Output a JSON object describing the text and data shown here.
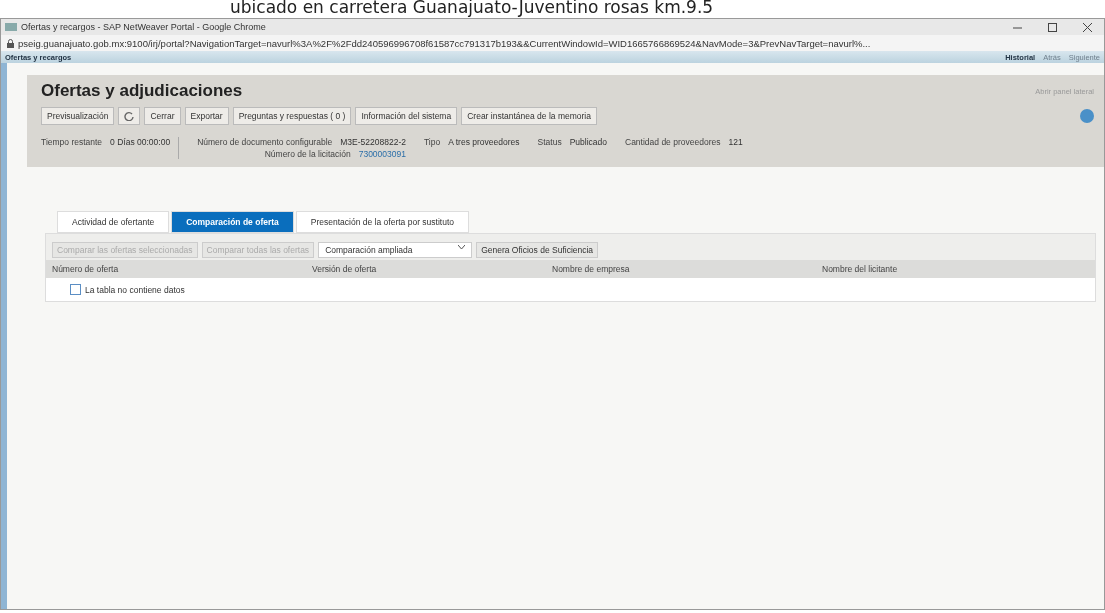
{
  "document_text": "ubicado en carretera Guanajuato-Juventino rosas km.9.5",
  "browser": {
    "title": "Ofertas y recargos - SAP NetWeaver Portal - Google Chrome",
    "url": "pseig.guanajuato.gob.mx:9100/irj/portal?NavigationTarget=navurl%3A%2F%2Fdd240596996708f61587cc791317b193&&CurrentWindowId=WID1665766869524&NavMode=3&PrevNavTarget=navurl%..."
  },
  "portal": {
    "title": "Ofertas y recargos",
    "nav": [
      {
        "label": "Historial",
        "disabled": false
      },
      {
        "label": "Atrás",
        "disabled": true
      },
      {
        "label": "Siguiente",
        "disabled": true
      }
    ]
  },
  "page": {
    "title": "Ofertas y adjudicaciones",
    "side_link": "Abrir panel lateral",
    "toolbar": [
      {
        "kind": "text",
        "label": "Previsualización"
      },
      {
        "kind": "refresh"
      },
      {
        "kind": "text",
        "label": "Cerrar"
      },
      {
        "kind": "text",
        "label": "Exportar"
      },
      {
        "kind": "text",
        "label": "Preguntas y respuestas ( 0 )"
      },
      {
        "kind": "text",
        "label": "Información del sistema"
      },
      {
        "kind": "text",
        "label": "Crear instantánea de la memoria"
      }
    ],
    "info": [
      {
        "label": "Tiempo restante",
        "value": "0 Días 00:00:00"
      },
      {
        "label": "Número de documento configurable",
        "value": "M3E-52208822-2",
        "sub_label": "Número de la licitación",
        "sub_value": "7300003091"
      },
      {
        "label": "Tipo",
        "value": "A tres proveedores"
      },
      {
        "label": "Status",
        "value": "Publicado"
      },
      {
        "label": "Cantidad de proveedores",
        "value": "121"
      }
    ]
  },
  "tabs": [
    {
      "label": "Actividad de ofertante",
      "selected": false
    },
    {
      "label": "Comparación de oferta",
      "selected": true
    },
    {
      "label": "Presentación de la oferta por sustituto",
      "selected": false
    }
  ],
  "table_toolbar": [
    {
      "kind": "button",
      "label": "Comparar las ofertas seleccionadas",
      "disabled": true
    },
    {
      "kind": "button",
      "label": "Comparar todas las ofertas",
      "disabled": true
    },
    {
      "kind": "select",
      "label": "Comparación ampliada"
    },
    {
      "kind": "button",
      "label": "Genera Oficios de Suficiencia",
      "disabled": false
    }
  ],
  "table": {
    "columns": [
      "Número de oferta",
      "Versión de oferta",
      "Nombre de empresa",
      "Nombre del licitante"
    ],
    "empty_text": "La tabla no contiene datos"
  }
}
